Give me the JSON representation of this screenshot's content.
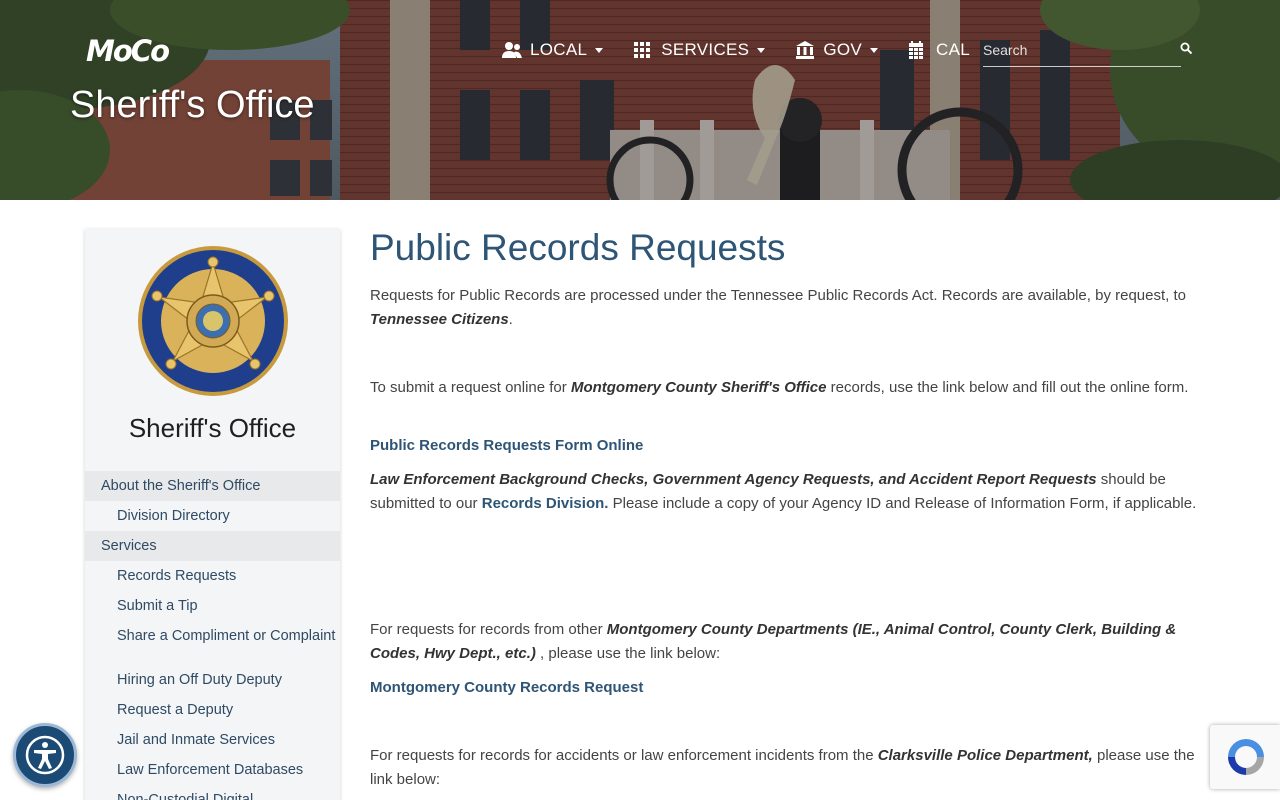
{
  "header": {
    "logo_text": "MoCo",
    "site_title": "Sheriff's Office",
    "nav": [
      {
        "label": "LOCAL",
        "icon": "users-icon",
        "has_dropdown": true
      },
      {
        "label": "SERVICES",
        "icon": "grid-icon",
        "has_dropdown": true
      },
      {
        "label": "GOV",
        "icon": "building-columns-icon",
        "has_dropdown": true
      },
      {
        "label": "CAL",
        "icon": "calendar-icon",
        "has_dropdown": false
      }
    ],
    "search": {
      "placeholder": "Search",
      "value": ""
    }
  },
  "sidebar": {
    "title": "Sheriff's Office",
    "badge_icon": "sheriff-badge-icon",
    "menu": [
      {
        "label": "About the Sheriff's Office",
        "level": 1
      },
      {
        "label": "Division Directory",
        "level": 2
      },
      {
        "label": "Services",
        "level": 1
      },
      {
        "label": "Records Requests",
        "level": 2
      },
      {
        "label": "Submit a Tip",
        "level": 2
      },
      {
        "label": "Share a Compliment or Complaint",
        "level": 2
      },
      {
        "label": "Hiring an Off Duty Deputy",
        "level": 2
      },
      {
        "label": "Request a Deputy",
        "level": 2
      },
      {
        "label": "Jail and Inmate Services",
        "level": 2
      },
      {
        "label": "Law Enforcement Databases",
        "level": 2
      },
      {
        "label": "Non-Custodial Digital",
        "level": 2
      }
    ]
  },
  "main": {
    "title": "Public Records Requests",
    "p1": {
      "text": "Requests for Public Records are processed under the Tennessee Public Records Act. Records are available, by request, to ",
      "emphasis": "Tennessee Citizens",
      "end": "."
    },
    "p2": {
      "text": "To submit a request online for ",
      "emphasis": "Montgomery County Sheriff's Office",
      "end": " records, use the link below and fill out the online form."
    },
    "link1": "Public Records Requests Form Online",
    "p3": {
      "emphasis": "Law Enforcement Background Checks, Government Agency Requests, and Accident Report Requests",
      "text": " should be submitted to our ",
      "link": "Records Division.",
      "end": " Please include a copy of your Agency ID and Release of Information Form, if applicable."
    },
    "p4": {
      "text": "For requests for records from other ",
      "emphasis": "Montgomery County Departments (IE., Animal Control, County Clerk, Building & Codes, Hwy Dept., etc.)",
      "end": "  , please use the link below:"
    },
    "link2": "Montgomery County Records Request",
    "p5": {
      "text": "For requests for records for accidents or law enforcement incidents from the ",
      "emphasis": "Clarksville Police Department,",
      "end": " please use the link below:"
    }
  },
  "widgets": {
    "accessibility_icon": "accessibility-icon",
    "recaptcha_icon": "recaptcha-icon"
  },
  "colors": {
    "heading": "#2e5575",
    "link": "#2e5575",
    "a11y_button": "#1b4b74"
  }
}
